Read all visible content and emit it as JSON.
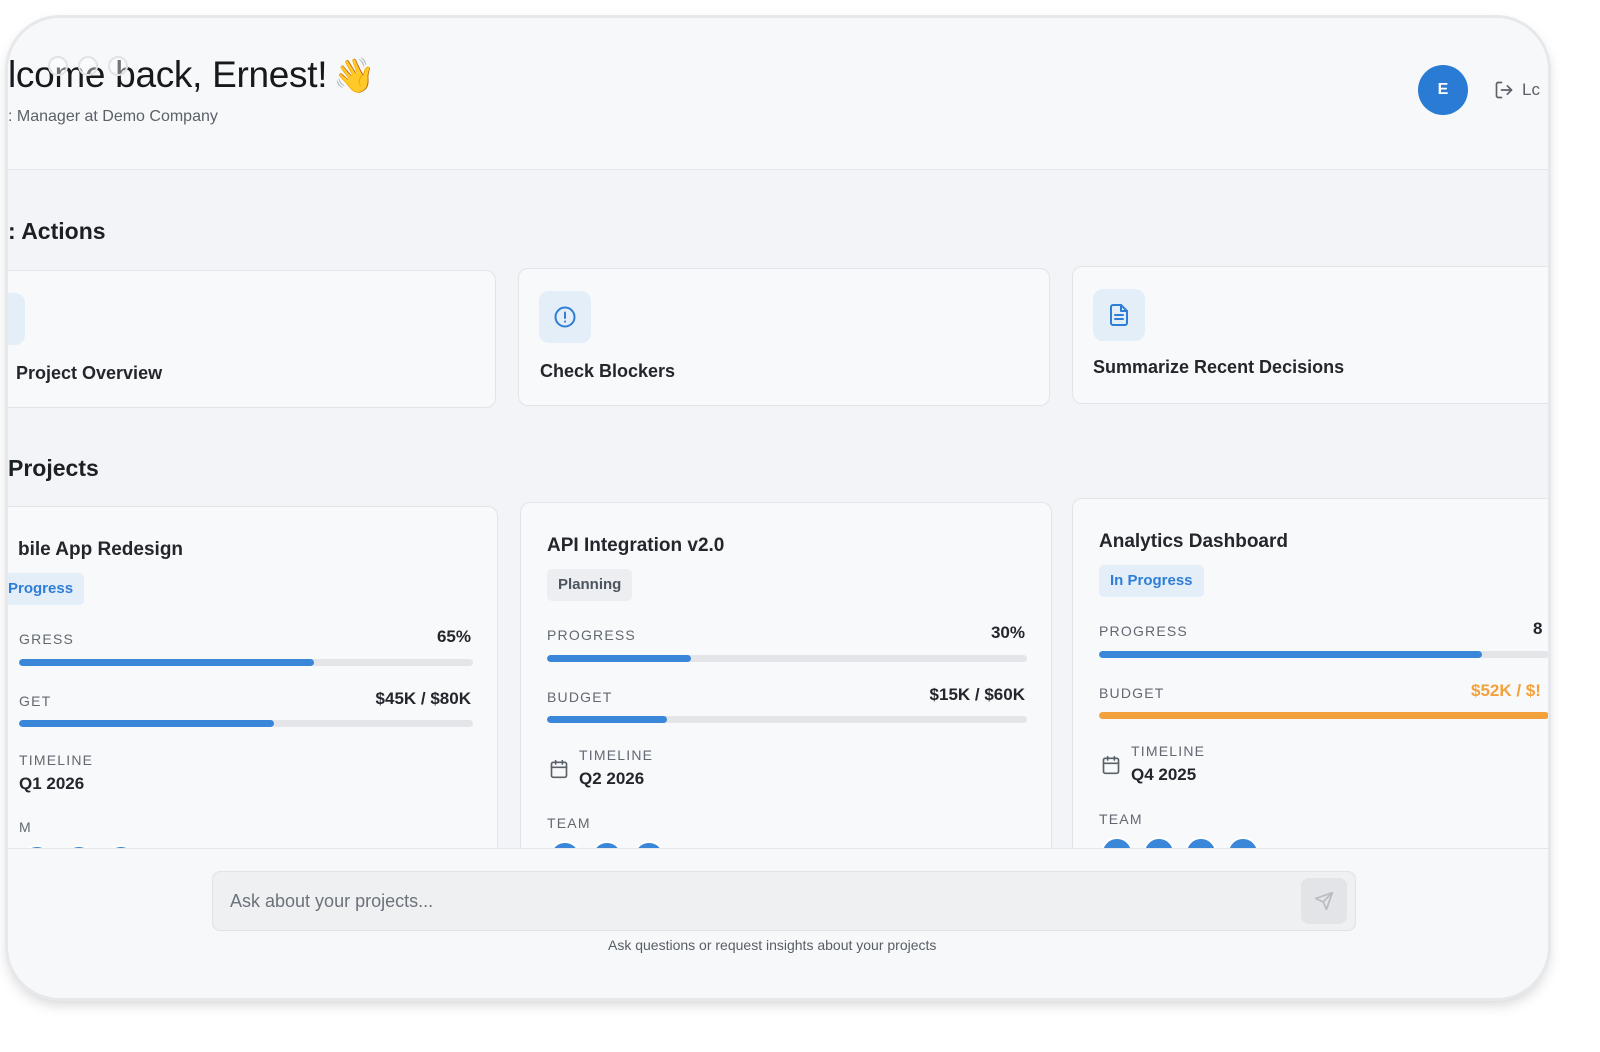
{
  "header": {
    "greeting": "lcome back, Ernest!",
    "greeting_emoji": "👋",
    "subtitle": ": Manager at Demo Company",
    "avatar_initial": "E",
    "logout_label": "Lc"
  },
  "quick_actions": {
    "title": ": Actions",
    "items": [
      {
        "label": "Project Overview",
        "icon": "chart-icon"
      },
      {
        "label": "Check Blockers",
        "icon": "alert-circle-icon"
      },
      {
        "label": "Summarize Recent Decisions",
        "icon": "document-icon"
      }
    ]
  },
  "projects": {
    "title": "Projects",
    "labels": {
      "progress": "PROGRESS",
      "budget": "BUDGET",
      "timeline": "TIMELINE",
      "team": "TEAM"
    },
    "items": [
      {
        "name": "bile App Redesign",
        "status": "Progress",
        "progress_label": "GRESS",
        "progress_text": "65%",
        "progress": 0.65,
        "budget_label": "GET",
        "budget_text": "$45K / $80K",
        "budget": 0.5625,
        "timeline_label": "TIMELINE",
        "timeline": "Q1 2026",
        "team_label": "M"
      },
      {
        "name": "API Integration v2.0",
        "status": "Planning",
        "progress_label": "PROGRESS",
        "progress_text": "30%",
        "progress": 0.3,
        "budget_label": "BUDGET",
        "budget_text": "$15K / $60K",
        "budget": 0.25,
        "timeline_label": "TIMELINE",
        "timeline": "Q2 2026",
        "team_label": "TEAM"
      },
      {
        "name": "Analytics Dashboard",
        "status": "In Progress",
        "progress_label": "PROGRESS",
        "progress_text": "8",
        "progress": 0.85,
        "budget_label": "BUDGET",
        "budget_text": "$52K / $!",
        "budget": 1.0,
        "timeline_label": "TIMELINE",
        "timeline": "Q4 2025",
        "team_label": "TEAM"
      }
    ]
  },
  "chat": {
    "placeholder": "Ask about your projects...",
    "hint": "Ask questions or request insights about your projects"
  },
  "colors": {
    "accent": "#3a86d9",
    "warning": "#f3a13a",
    "avatar": "#2a7bd4"
  }
}
